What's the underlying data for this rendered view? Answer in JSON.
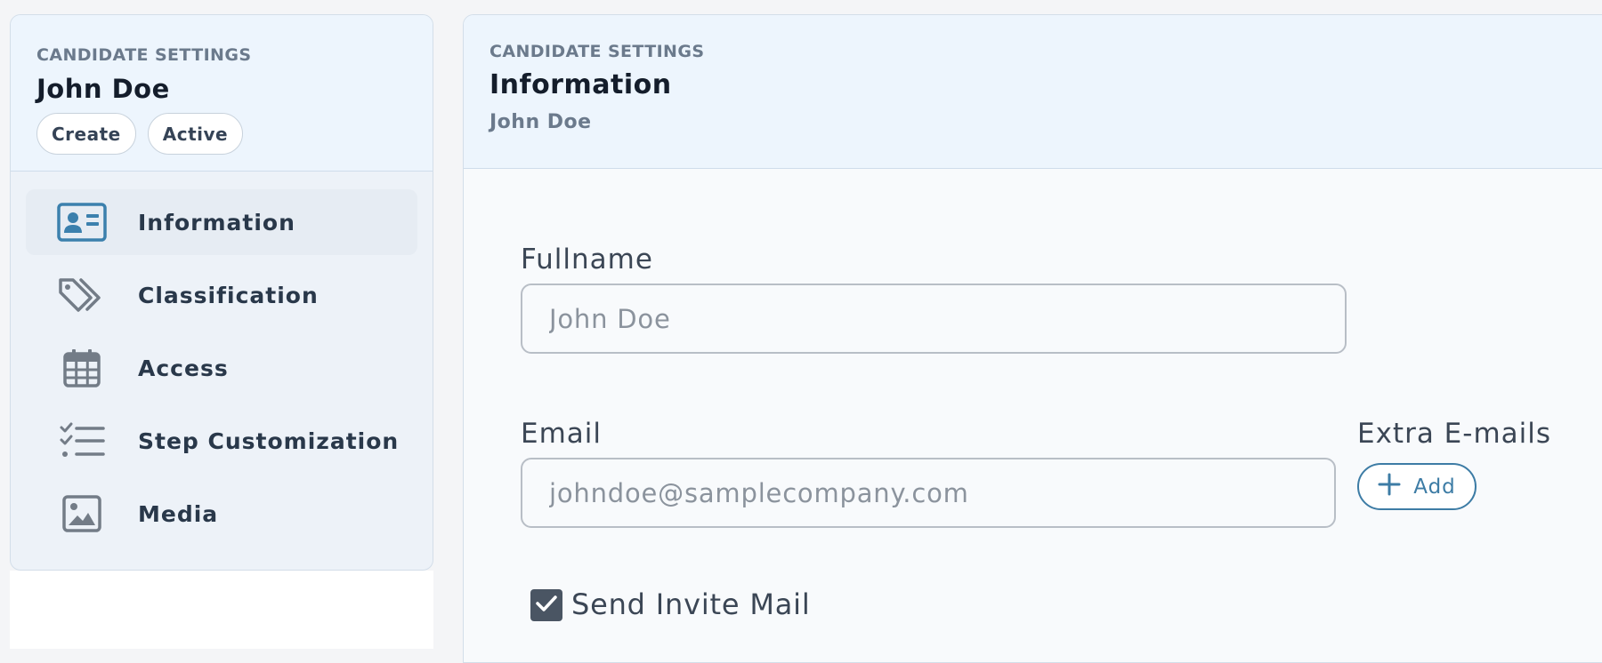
{
  "sidebar": {
    "eyebrow": "CANDIDATE SETTINGS",
    "title": "John Doe",
    "badges": [
      "Create",
      "Active"
    ],
    "items": [
      {
        "label": "Information",
        "icon": "id-card-icon",
        "active": true
      },
      {
        "label": "Classification",
        "icon": "tags-icon",
        "active": false
      },
      {
        "label": "Access",
        "icon": "calendar-icon",
        "active": false
      },
      {
        "label": "Step Customization",
        "icon": "checklist-icon",
        "active": false
      },
      {
        "label": "Media",
        "icon": "image-icon",
        "active": false
      }
    ]
  },
  "header": {
    "eyebrow": "CANDIDATE SETTINGS",
    "title": "Information",
    "subtitle": "John Doe"
  },
  "form": {
    "fullname": {
      "label": "Fullname",
      "placeholder": "John Doe"
    },
    "email": {
      "label": "Email",
      "placeholder": "johndoe@samplecompany.com"
    },
    "extra_emails": {
      "label": "Extra E-mails",
      "add_label": "Add"
    },
    "invite": {
      "label": "Send Invite Mail",
      "checked": true
    }
  },
  "colors": {
    "accent": "#3d7ca5",
    "active_icon": "#3b80ad",
    "icon_gray": "#737c87"
  }
}
